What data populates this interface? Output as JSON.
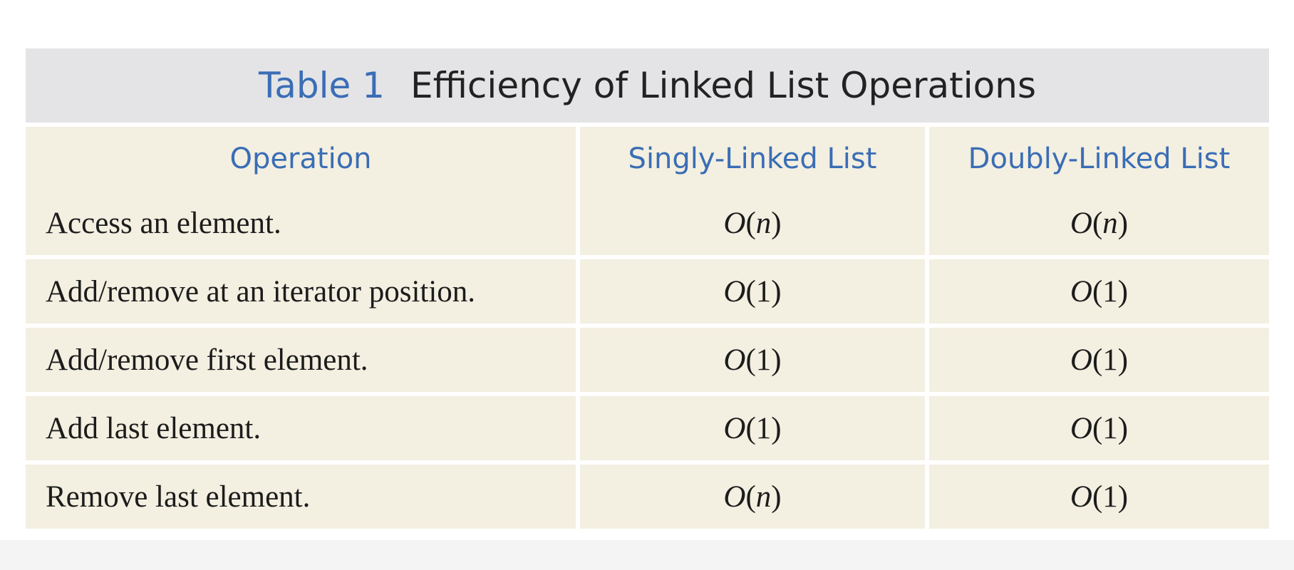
{
  "table": {
    "label": "Table 1",
    "title": "Efficiency of Linked List Operations",
    "headers": [
      "Operation",
      "Singly-Linked List",
      "Doubly-Linked List"
    ],
    "rows": [
      {
        "operation": "Access an element.",
        "singly": "O(n)",
        "doubly": "O(n)"
      },
      {
        "operation": "Add/remove at an iterator position.",
        "singly": "O(1)",
        "doubly": "O(1)"
      },
      {
        "operation": "Add/remove first element.",
        "singly": "O(1)",
        "doubly": "O(1)"
      },
      {
        "operation": "Add last element.",
        "singly": "O(1)",
        "doubly": "O(1)"
      },
      {
        "operation": "Remove last element.",
        "singly": "O(n)",
        "doubly": "O(1)"
      }
    ]
  },
  "colors": {
    "accent_blue": "#3a6db5",
    "caption_background": "#e4e4e6",
    "cell_background": "#f3efe1",
    "text": "#1c1c1c"
  }
}
